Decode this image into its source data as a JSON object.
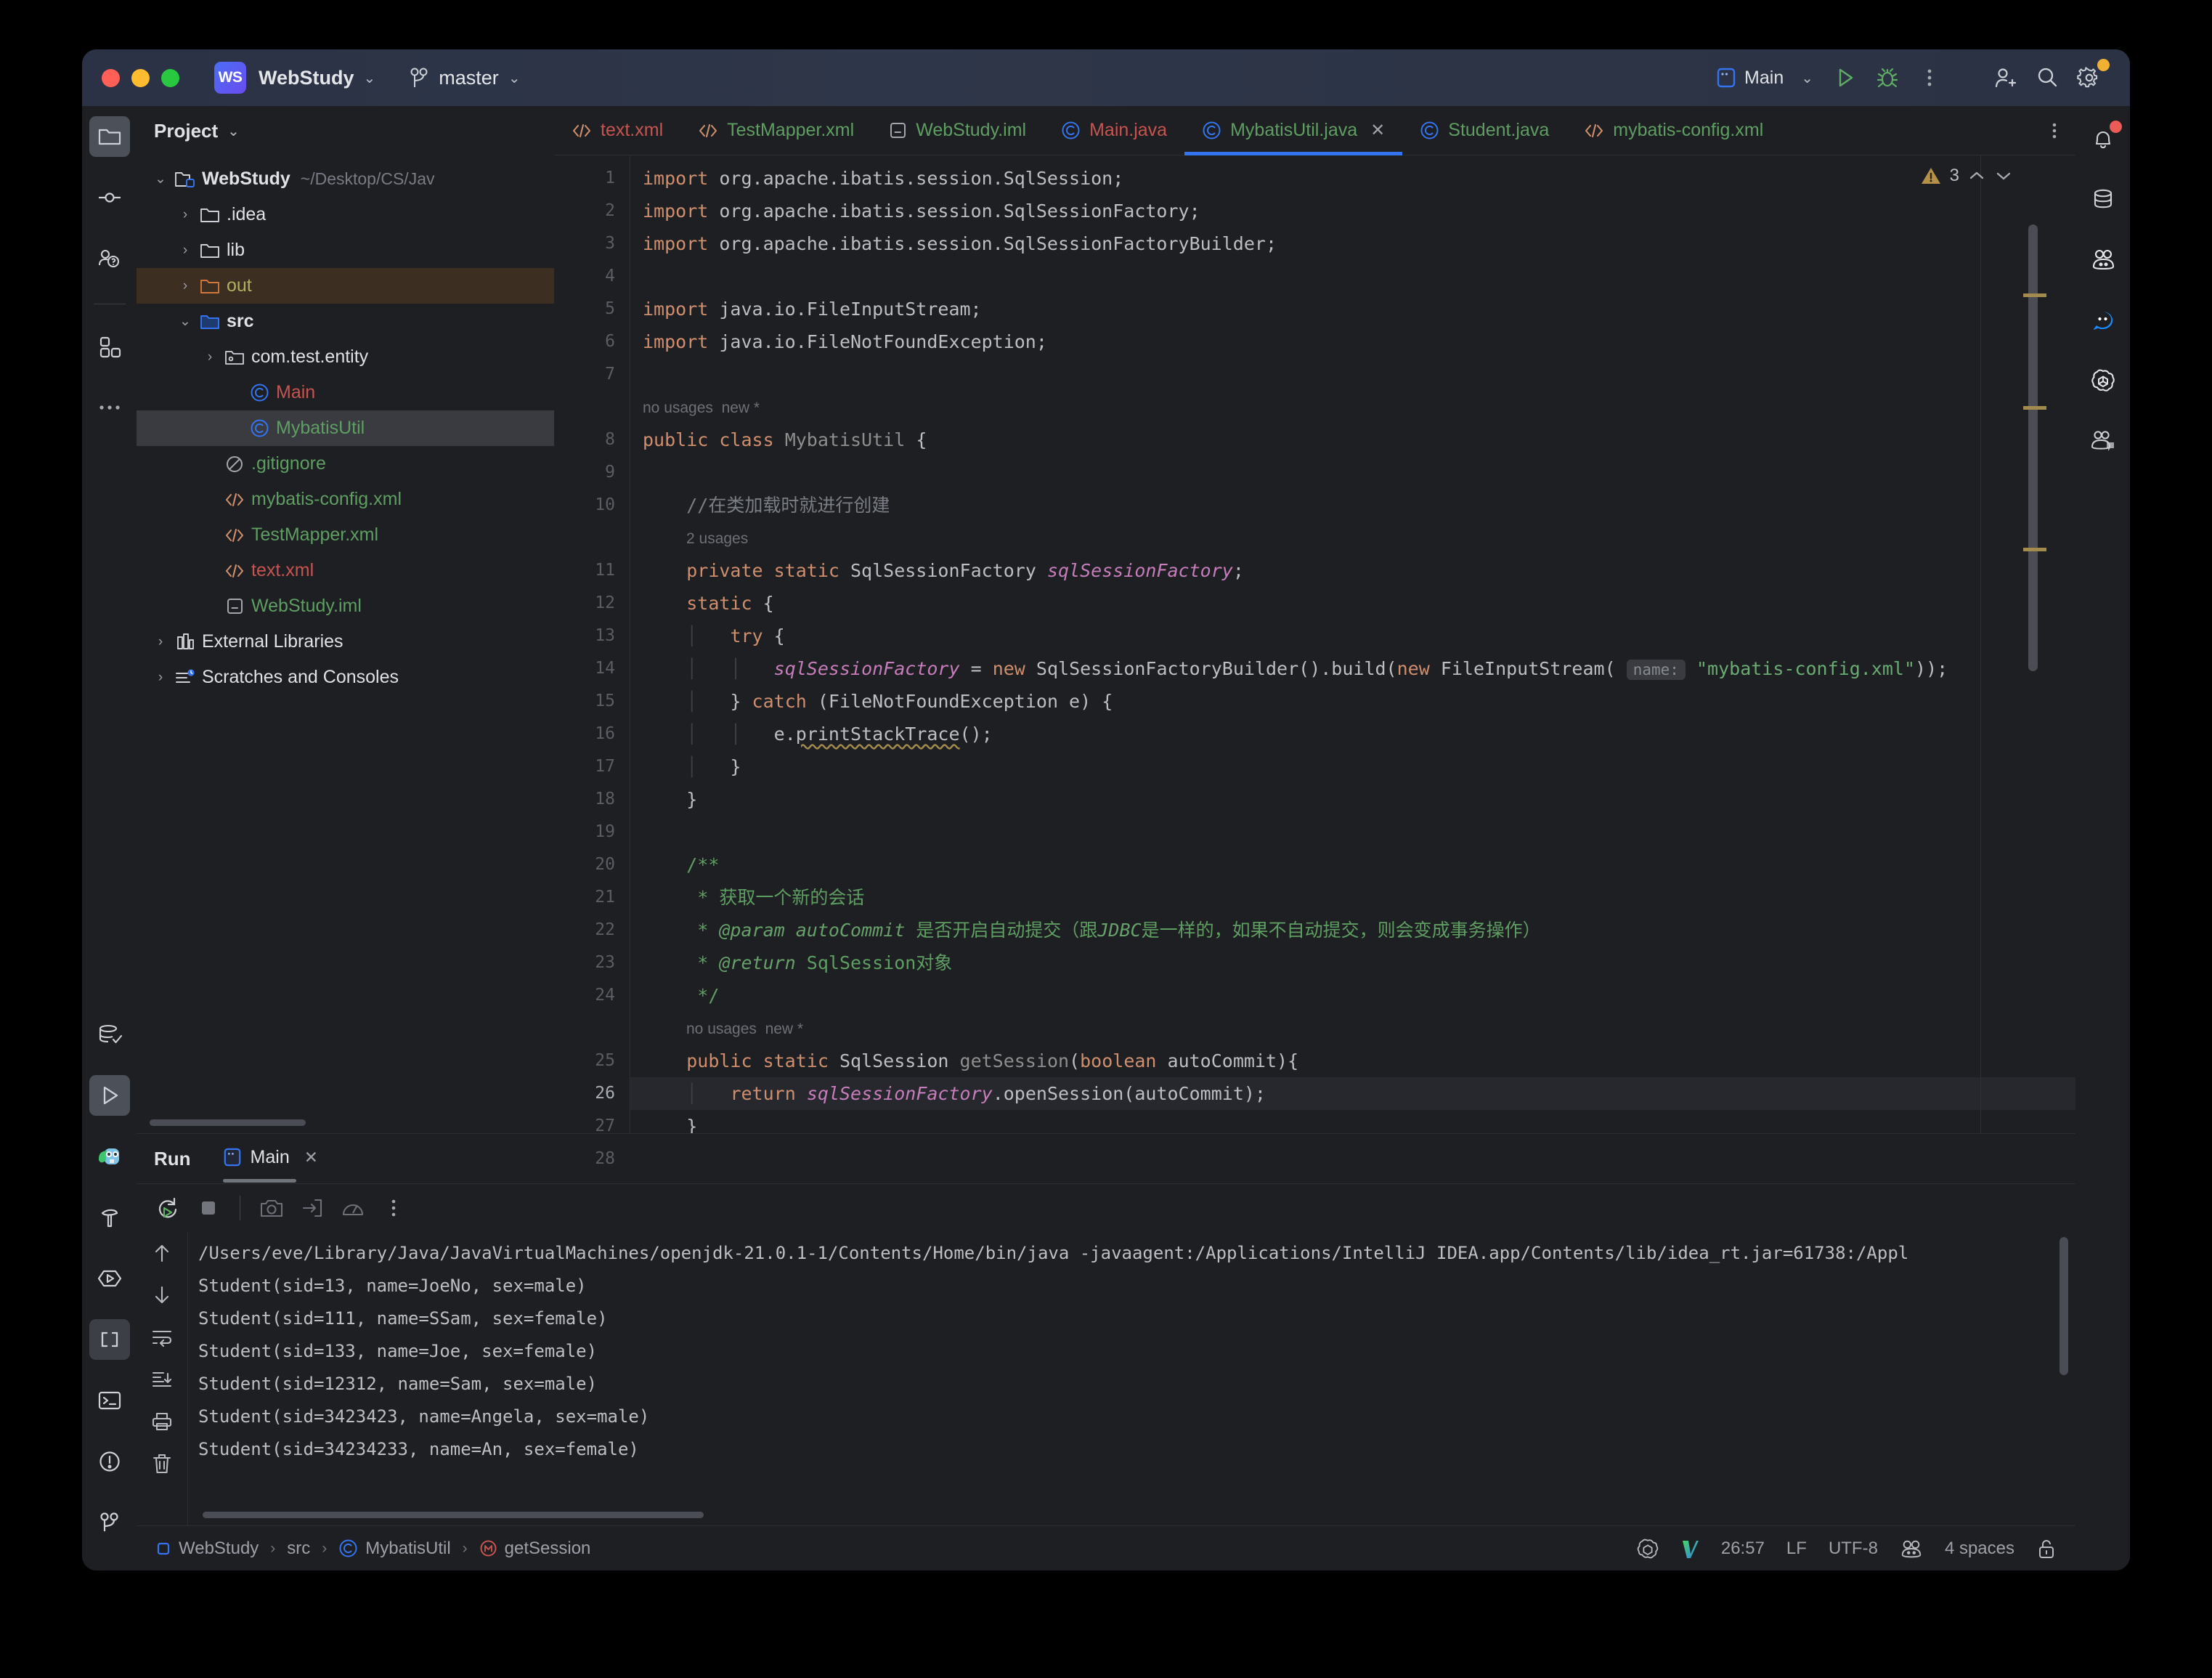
{
  "window": {
    "project_badge": "WS",
    "project_name": "WebStudy",
    "branch": "master",
    "run_config": "Main"
  },
  "left_rail": {
    "items": [
      {
        "name": "project-tool-window",
        "icon": "folder-icon",
        "active": true
      },
      {
        "name": "commit-tool-window",
        "icon": "commit-icon",
        "active": false
      },
      {
        "name": "pull-requests-tool-window",
        "icon": "people-question-icon",
        "active": false
      },
      {
        "name": "plugins-tool-window",
        "icon": "squares-icon",
        "active": false
      },
      {
        "name": "more-tool-windows",
        "icon": "ellipsis-icon",
        "active": false
      }
    ],
    "bottom_items": [
      {
        "name": "database-tool-window",
        "icon": "database-check-icon",
        "active": false
      },
      {
        "name": "run-tool-window",
        "icon": "play-icon",
        "active": true
      },
      {
        "name": "jetbrains-ai-tool-window",
        "icon": "owl-icon",
        "active": false
      },
      {
        "name": "build-tool-window",
        "icon": "hammer-icon",
        "active": false
      },
      {
        "name": "services-tool-window",
        "icon": "hexagon-play-icon",
        "active": false
      },
      {
        "name": "structure-tool-window",
        "icon": "brackets-icon",
        "active": false
      },
      {
        "name": "terminal-tool-window",
        "icon": "terminal-icon",
        "active": false
      },
      {
        "name": "problems-tool-window",
        "icon": "exclamation-circle-icon",
        "active": false
      },
      {
        "name": "git-tool-window",
        "icon": "branch-icon",
        "active": false
      }
    ]
  },
  "project_panel": {
    "title": "Project",
    "tree": [
      {
        "depth": 0,
        "arrow": "down",
        "icon": "module-folder-icon",
        "label": "WebStudy",
        "path": "~/Desktop/CS/Jav",
        "bold": true,
        "color": "#dfe1e5",
        "state": "normal"
      },
      {
        "depth": 1,
        "arrow": "right",
        "icon": "folder-icon",
        "label": ".idea",
        "path": "",
        "bold": false,
        "color": "#dfe1e5",
        "state": "normal"
      },
      {
        "depth": 1,
        "arrow": "right",
        "icon": "folder-icon",
        "label": "lib",
        "path": "",
        "bold": false,
        "color": "#dfe1e5",
        "state": "normal"
      },
      {
        "depth": 1,
        "arrow": "right",
        "icon": "folder-out-icon",
        "label": "out",
        "path": "",
        "bold": false,
        "color": "#b3ae60",
        "state": "highlight"
      },
      {
        "depth": 1,
        "arrow": "down",
        "icon": "folder-src-icon",
        "label": "src",
        "path": "",
        "bold": true,
        "color": "#dfe1e5",
        "state": "normal"
      },
      {
        "depth": 2,
        "arrow": "right",
        "icon": "package-icon",
        "label": "com.test.entity",
        "path": "",
        "bold": false,
        "color": "#dfe1e5",
        "state": "normal"
      },
      {
        "depth": 3,
        "arrow": "none",
        "icon": "class-icon",
        "label": "Main",
        "path": "",
        "bold": false,
        "color": "#c75450",
        "state": "normal"
      },
      {
        "depth": 3,
        "arrow": "none",
        "icon": "class-icon",
        "label": "MybatisUtil",
        "path": "",
        "bold": false,
        "color": "#5f9e63",
        "state": "selected"
      },
      {
        "depth": 2,
        "arrow": "none",
        "icon": "gitignore-icon",
        "label": ".gitignore",
        "path": "",
        "bold": false,
        "color": "#5f9e63",
        "state": "normal"
      },
      {
        "depth": 2,
        "arrow": "none",
        "icon": "xml-icon",
        "label": "mybatis-config.xml",
        "path": "",
        "bold": false,
        "color": "#5f9e63",
        "state": "normal"
      },
      {
        "depth": 2,
        "arrow": "none",
        "icon": "xml-icon",
        "label": "TestMapper.xml",
        "path": "",
        "bold": false,
        "color": "#5f9e63",
        "state": "normal"
      },
      {
        "depth": 2,
        "arrow": "none",
        "icon": "xml-icon",
        "label": "text.xml",
        "path": "",
        "bold": false,
        "color": "#c75450",
        "state": "normal"
      },
      {
        "depth": 2,
        "arrow": "none",
        "icon": "iml-icon",
        "label": "WebStudy.iml",
        "path": "",
        "bold": false,
        "color": "#5f9e63",
        "state": "normal"
      },
      {
        "depth": 0,
        "arrow": "right",
        "icon": "libraries-icon",
        "label": "External Libraries",
        "path": "",
        "bold": false,
        "color": "#dfe1e5",
        "state": "normal"
      },
      {
        "depth": 0,
        "arrow": "right",
        "icon": "scratches-icon",
        "label": "Scratches and Consoles",
        "path": "",
        "bold": false,
        "color": "#dfe1e5",
        "state": "normal"
      }
    ]
  },
  "editor": {
    "tabs": [
      {
        "label": "text.xml",
        "icon": "xml-icon",
        "color": "#c75450",
        "active": false,
        "closable": false
      },
      {
        "label": "TestMapper.xml",
        "icon": "xml-icon",
        "color": "#5f9e63",
        "active": false,
        "closable": false
      },
      {
        "label": "WebStudy.iml",
        "icon": "iml-icon",
        "color": "#5f9e63",
        "active": false,
        "closable": false
      },
      {
        "label": "Main.java",
        "icon": "class-icon",
        "color": "#c75450",
        "active": false,
        "closable": false
      },
      {
        "label": "MybatisUtil.java",
        "icon": "class-icon",
        "color": "#5f9e63",
        "active": true,
        "closable": true
      },
      {
        "label": "Student.java",
        "icon": "class-icon",
        "color": "#5f9e63",
        "active": false,
        "closable": false
      },
      {
        "label": "mybatis-config.xml",
        "icon": "xml-icon",
        "color": "#5f9e63",
        "active": false,
        "closable": false
      }
    ],
    "warning_count": "3",
    "lines": [
      {
        "n": "1",
        "html": "<span class='kw'>import</span> <span class='plain'>org.apache.ibatis.session.SqlSession;</span>"
      },
      {
        "n": "2",
        "html": "<span class='kw'>import</span> <span class='plain'>org.apache.ibatis.session.SqlSessionFactory;</span>"
      },
      {
        "n": "3",
        "html": "<span class='kw'>import</span> <span class='plain'>org.apache.ibatis.session.SqlSessionFactoryBuilder;</span>"
      },
      {
        "n": "4",
        "html": ""
      },
      {
        "n": "5",
        "html": "<span class='kw'>import</span> <span class='plain'>java.io.FileInputStream;</span>"
      },
      {
        "n": "6",
        "html": "<span class='kw'>import</span> <span class='plain'>java.io.FileNotFoundException;</span>"
      },
      {
        "n": "7",
        "html": ""
      },
      {
        "n": "",
        "hint": true,
        "html": "no usages&nbsp;&nbsp;new *"
      },
      {
        "n": "8",
        "html": "<span class='kw'>public class</span> <span class='mth'>MybatisUtil</span> <span class='plain'>{</span>"
      },
      {
        "n": "9",
        "html": ""
      },
      {
        "n": "10",
        "html": "    <span class='cmt'>//在类加载时就进行创建</span>"
      },
      {
        "n": "",
        "hint": true,
        "indent": 4,
        "html": "2 usages"
      },
      {
        "n": "11",
        "html": "    <span class='kw'>private static</span> <span class='plain'>SqlSessionFactory</span> <span class='fld'>sqlSessionFactory</span><span class='plain'>;</span>"
      },
      {
        "n": "12",
        "html": "    <span class='kw'>static</span> <span class='plain'>{</span>"
      },
      {
        "n": "13",
        "html": "    <span class='indentguide'>│</span>   <span class='kw'>try</span> <span class='plain'>{</span>"
      },
      {
        "n": "14",
        "html": "    <span class='indentguide'>│</span>   <span class='indentguide'>│</span>   <span class='fld'>sqlSessionFactory</span> <span class='plain'>= </span><span class='kw'>new</span><span class='plain'> SqlSessionFactoryBuilder().build(</span><span class='kw'>new</span><span class='plain'> FileInputStream( </span><span class='hintchip'>name:</span><span class='plain'> </span><span class='str'>\"mybatis-config.xml\"</span><span class='plain'>));</span>"
      },
      {
        "n": "15",
        "html": "    <span class='indentguide'>│</span>   <span class='plain'>} </span><span class='kw'>catch</span><span class='plain'> (FileNotFoundException e) {</span>"
      },
      {
        "n": "16",
        "html": "    <span class='indentguide'>│</span>   <span class='indentguide'>│</span>   <span class='plain'>e.</span><span class='plain squiggle'>printStackTrace</span><span class='plain'>();</span>"
      },
      {
        "n": "17",
        "html": "    <span class='indentguide'>│</span>   <span class='plain'>}</span>"
      },
      {
        "n": "18",
        "html": "    <span class='plain'>}</span>"
      },
      {
        "n": "19",
        "html": ""
      },
      {
        "n": "20",
        "html": "    <span class='doc'>/**</span>"
      },
      {
        "n": "21",
        "html": "     <span class='doc'>* 获取一个新的会话</span>"
      },
      {
        "n": "22",
        "html": "     <span class='doc'>* </span><span class='doctag'>@param</span> <span class='doctag'>autoCommit</span> <span class='doc'>是否开启自动提交（跟</span><span class='doctag'>JDBC</span><span class='doc'>是一样的，如果不自动提交，则会变成事务操作）</span>"
      },
      {
        "n": "23",
        "html": "     <span class='doc'>* </span><span class='doctag'>@return</span> <span class='doc'>SqlSession对象</span>"
      },
      {
        "n": "24",
        "html": "     <span class='doc'>*/</span>"
      },
      {
        "n": "",
        "hint": true,
        "indent": 4,
        "html": "no usages&nbsp;&nbsp;new *"
      },
      {
        "n": "25",
        "html": "    <span class='kw'>public static</span> <span class='plain'>SqlSession </span><span class='mth'>getSession</span><span class='plain'>(</span><span class='kw'>boolean</span><span class='plain'> autoCommit){</span>"
      },
      {
        "n": "26",
        "cur": true,
        "html": "    <span class='indentguide'>│</span>   <span class='kw'>return</span> <span class='fld'>sqlSessionFactory</span><span class='plain'>.openSession(autoCommit);</span>"
      },
      {
        "n": "27",
        "html": "    <span class='plain'>}</span>"
      },
      {
        "n": "28",
        "html": "<span class='plain'>}</span>"
      }
    ]
  },
  "run_panel": {
    "title": "Run",
    "tab_label": "Main",
    "toolbar": [
      {
        "name": "rerun-button",
        "icon": "rerun-icon"
      },
      {
        "name": "stop-button",
        "icon": "stop-icon"
      },
      {
        "name": "screenshot-button",
        "icon": "camera-icon"
      },
      {
        "name": "dump-threads-button",
        "icon": "arrow-into-box-icon"
      },
      {
        "name": "profiler-button",
        "icon": "gauge-icon"
      },
      {
        "name": "more-options-button",
        "icon": "ellipsis-vertical-icon"
      }
    ],
    "side_rail": [
      {
        "name": "scroll-up-button",
        "icon": "arrow-up-icon"
      },
      {
        "name": "scroll-down-button",
        "icon": "arrow-down-icon"
      },
      {
        "name": "soft-wrap-button",
        "icon": "soft-wrap-icon"
      },
      {
        "name": "scroll-to-end-button",
        "icon": "scroll-end-icon"
      },
      {
        "name": "print-button",
        "icon": "printer-icon"
      },
      {
        "name": "clear-all-button",
        "icon": "trash-icon"
      }
    ],
    "console_lines": [
      "/Users/eve/Library/Java/JavaVirtualMachines/openjdk-21.0.1-1/Contents/Home/bin/java -javaagent:/Applications/IntelliJ IDEA.app/Contents/lib/idea_rt.jar=61738:/Appl",
      "Student(sid=13, name=JoeNo, sex=male)",
      "Student(sid=111, name=SSam, sex=female)",
      "Student(sid=133, name=Joe, sex=female)",
      "Student(sid=12312, name=Sam, sex=male)",
      "Student(sid=3423423, name=Angela, sex=male)",
      "Student(sid=34234233, name=An, sex=female)"
    ]
  },
  "status_bar": {
    "breadcrumb": [
      {
        "label": "WebStudy",
        "icon": "module-icon"
      },
      {
        "label": "src",
        "icon": "none"
      },
      {
        "label": "MybatisUtil",
        "icon": "class-icon"
      },
      {
        "label": "getSession",
        "icon": "method-icon"
      }
    ],
    "caret_position": "26:57",
    "line_separator": "LF",
    "encoding": "UTF-8",
    "indent": "4 spaces"
  },
  "right_rail": {
    "items": [
      {
        "name": "notifications-tool-window",
        "icon": "bell-icon",
        "badge": "#ec5b56"
      },
      {
        "name": "database-tool-window",
        "icon": "database-icon",
        "badge": ""
      },
      {
        "name": "ai-assistant-tool-window",
        "icon": "codegeex-icon",
        "badge": ""
      },
      {
        "name": "chat-tool-window",
        "icon": "chat-bubble-icon",
        "badge": ""
      },
      {
        "name": "chatgpt-tool-window",
        "icon": "openai-icon",
        "badge": ""
      },
      {
        "name": "ai-chat-tool-window",
        "icon": "codegeex-chat-icon",
        "badge": ""
      }
    ]
  },
  "colors": {
    "accent": "#3574f0",
    "bg": "#1e1f22",
    "titlebar": "#2e3649",
    "warning": "#a38b4e",
    "green": "#5f9e63",
    "red": "#c75450"
  }
}
